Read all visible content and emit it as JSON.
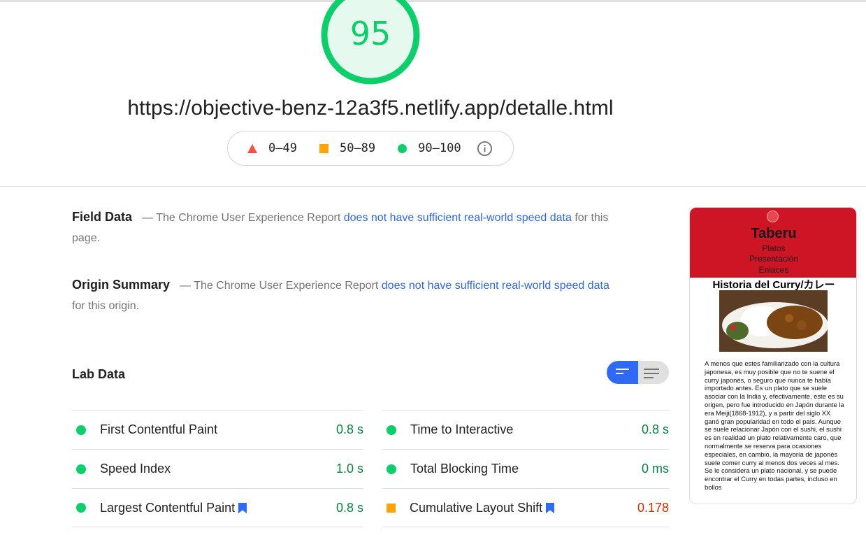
{
  "score": {
    "value": "95",
    "color": "#0cce6b"
  },
  "url": "https://objective-benz-12a3f5.netlify.app/detalle.html",
  "legend": {
    "fail": "0–49",
    "average": "50–89",
    "pass": "90–100"
  },
  "field_data": {
    "title": "Field Data",
    "prefix": "— The Chrome User Experience Report ",
    "link": "does not have sufficient real-world speed data",
    "suffix": " for this page."
  },
  "origin_summary": {
    "title": "Origin Summary",
    "prefix": "— The Chrome User Experience Report ",
    "link": "does not have sufficient real-world speed data",
    "suffix": " for this origin."
  },
  "lab_data": {
    "title": "Lab Data",
    "metrics_left": [
      {
        "label": "First Contentful Paint",
        "value": "0.8 s",
        "status": "pass",
        "bookmark": false
      },
      {
        "label": "Speed Index",
        "value": "1.0 s",
        "status": "pass",
        "bookmark": false
      },
      {
        "label": "Largest Contentful Paint",
        "value": "0.8 s",
        "status": "pass",
        "bookmark": true
      }
    ],
    "metrics_right": [
      {
        "label": "Time to Interactive",
        "value": "0.8 s",
        "status": "pass",
        "bookmark": false
      },
      {
        "label": "Total Blocking Time",
        "value": "0 ms",
        "status": "pass",
        "bookmark": false
      },
      {
        "label": "Cumulative Layout Shift",
        "value": "0.178",
        "status": "average",
        "bookmark": true
      }
    ]
  },
  "thumbnail": {
    "brand": "Taberu",
    "nav": [
      "Platos",
      "Presentación",
      "Enlaces"
    ],
    "heading": "Historia del Curry/カレー",
    "body": "A menos que estes familiarizado con la cultura japonesa, es muy posible que no te suene el curry japonés, o seguro que nunca te había importado antes. Es un plato que se suele asociar con la India y, efectivamente, este es su origen, pero fue introducido en Japón durante la era Meiji(1868-1912), y a partir del siglo XX ganó gran popularidad en todo el país. Aunque se suele relacionar Japón con el sushi, el sushi es en realidad un plato relativamente caro, que normalmente se reserva para ocasiones especiales, en cambio, la mayoría de japonés suele comer curry al menos dos veces al mes. Se le considera un plato nacional, y se puede encontrar el Curry en todas partes, incluso en bollos"
  },
  "colors": {
    "pass": "#0cce6b",
    "pass_text": "#0b8043",
    "average": "#ffa400",
    "average_text": "#c33300",
    "fail": "#ff4e42",
    "link": "#3367d6",
    "toggle_active": "#2f6af6",
    "thumb_header": "#cd1525"
  },
  "icons": {
    "info": "info-circle-icon",
    "bookmark": "bookmark-icon",
    "toggle_bars": "bar-view-icon",
    "toggle_list": "list-view-icon"
  }
}
